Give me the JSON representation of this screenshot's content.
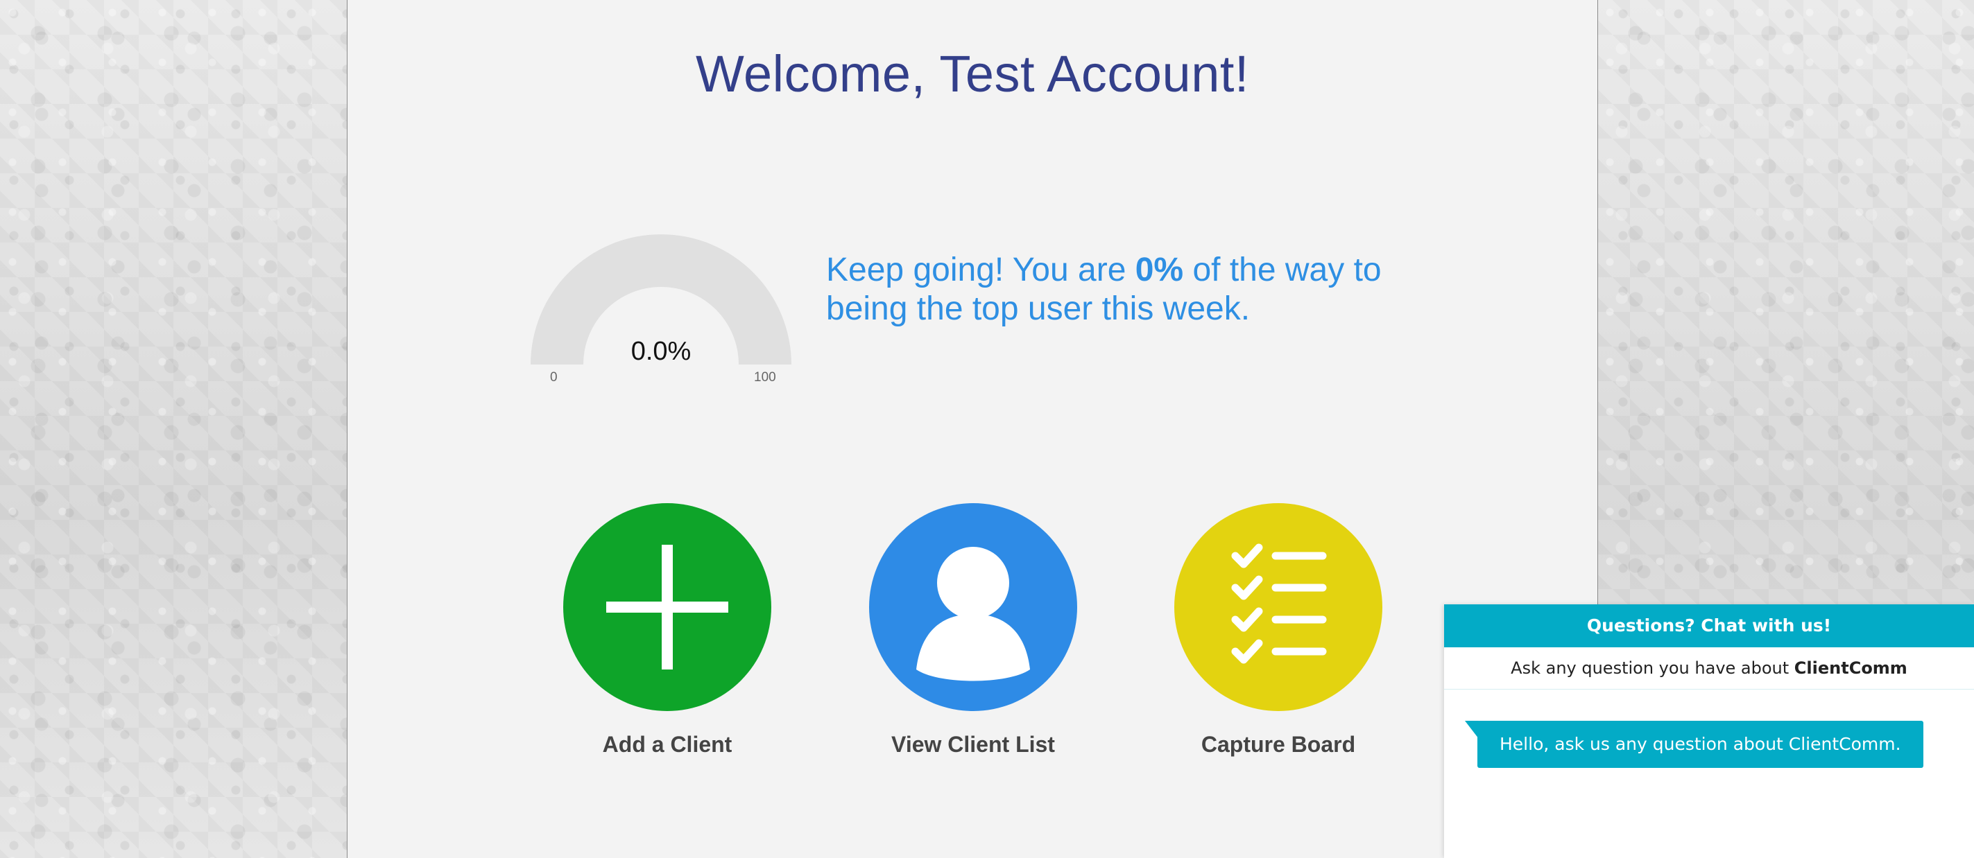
{
  "header": {
    "welcome_title": "Welcome, Test Account!"
  },
  "progress": {
    "gauge_value_text": "0.0%",
    "gauge_value": 0.0,
    "gauge_min": "0",
    "gauge_max": "100",
    "message_prefix": "Keep going! You are ",
    "message_percent": "0%",
    "message_suffix": " of the way to being the top user this week.",
    "gauge_track_color": "#e0e0e0"
  },
  "actions": [
    {
      "label": "Add a Client",
      "icon": "plus-icon",
      "color": "#0ea429"
    },
    {
      "label": "View Client List",
      "icon": "user-icon",
      "color": "#2e8be6"
    },
    {
      "label": "Capture Board",
      "icon": "checklist-icon",
      "color": "#e3d310"
    }
  ],
  "chat": {
    "header": "Questions? Chat with us!",
    "sub_prefix": "Ask any question you have about ",
    "sub_brand": "ClientComm",
    "welcome_message": "Hello, ask us any question about ClientComm.",
    "accent_color": "#03abc6"
  }
}
